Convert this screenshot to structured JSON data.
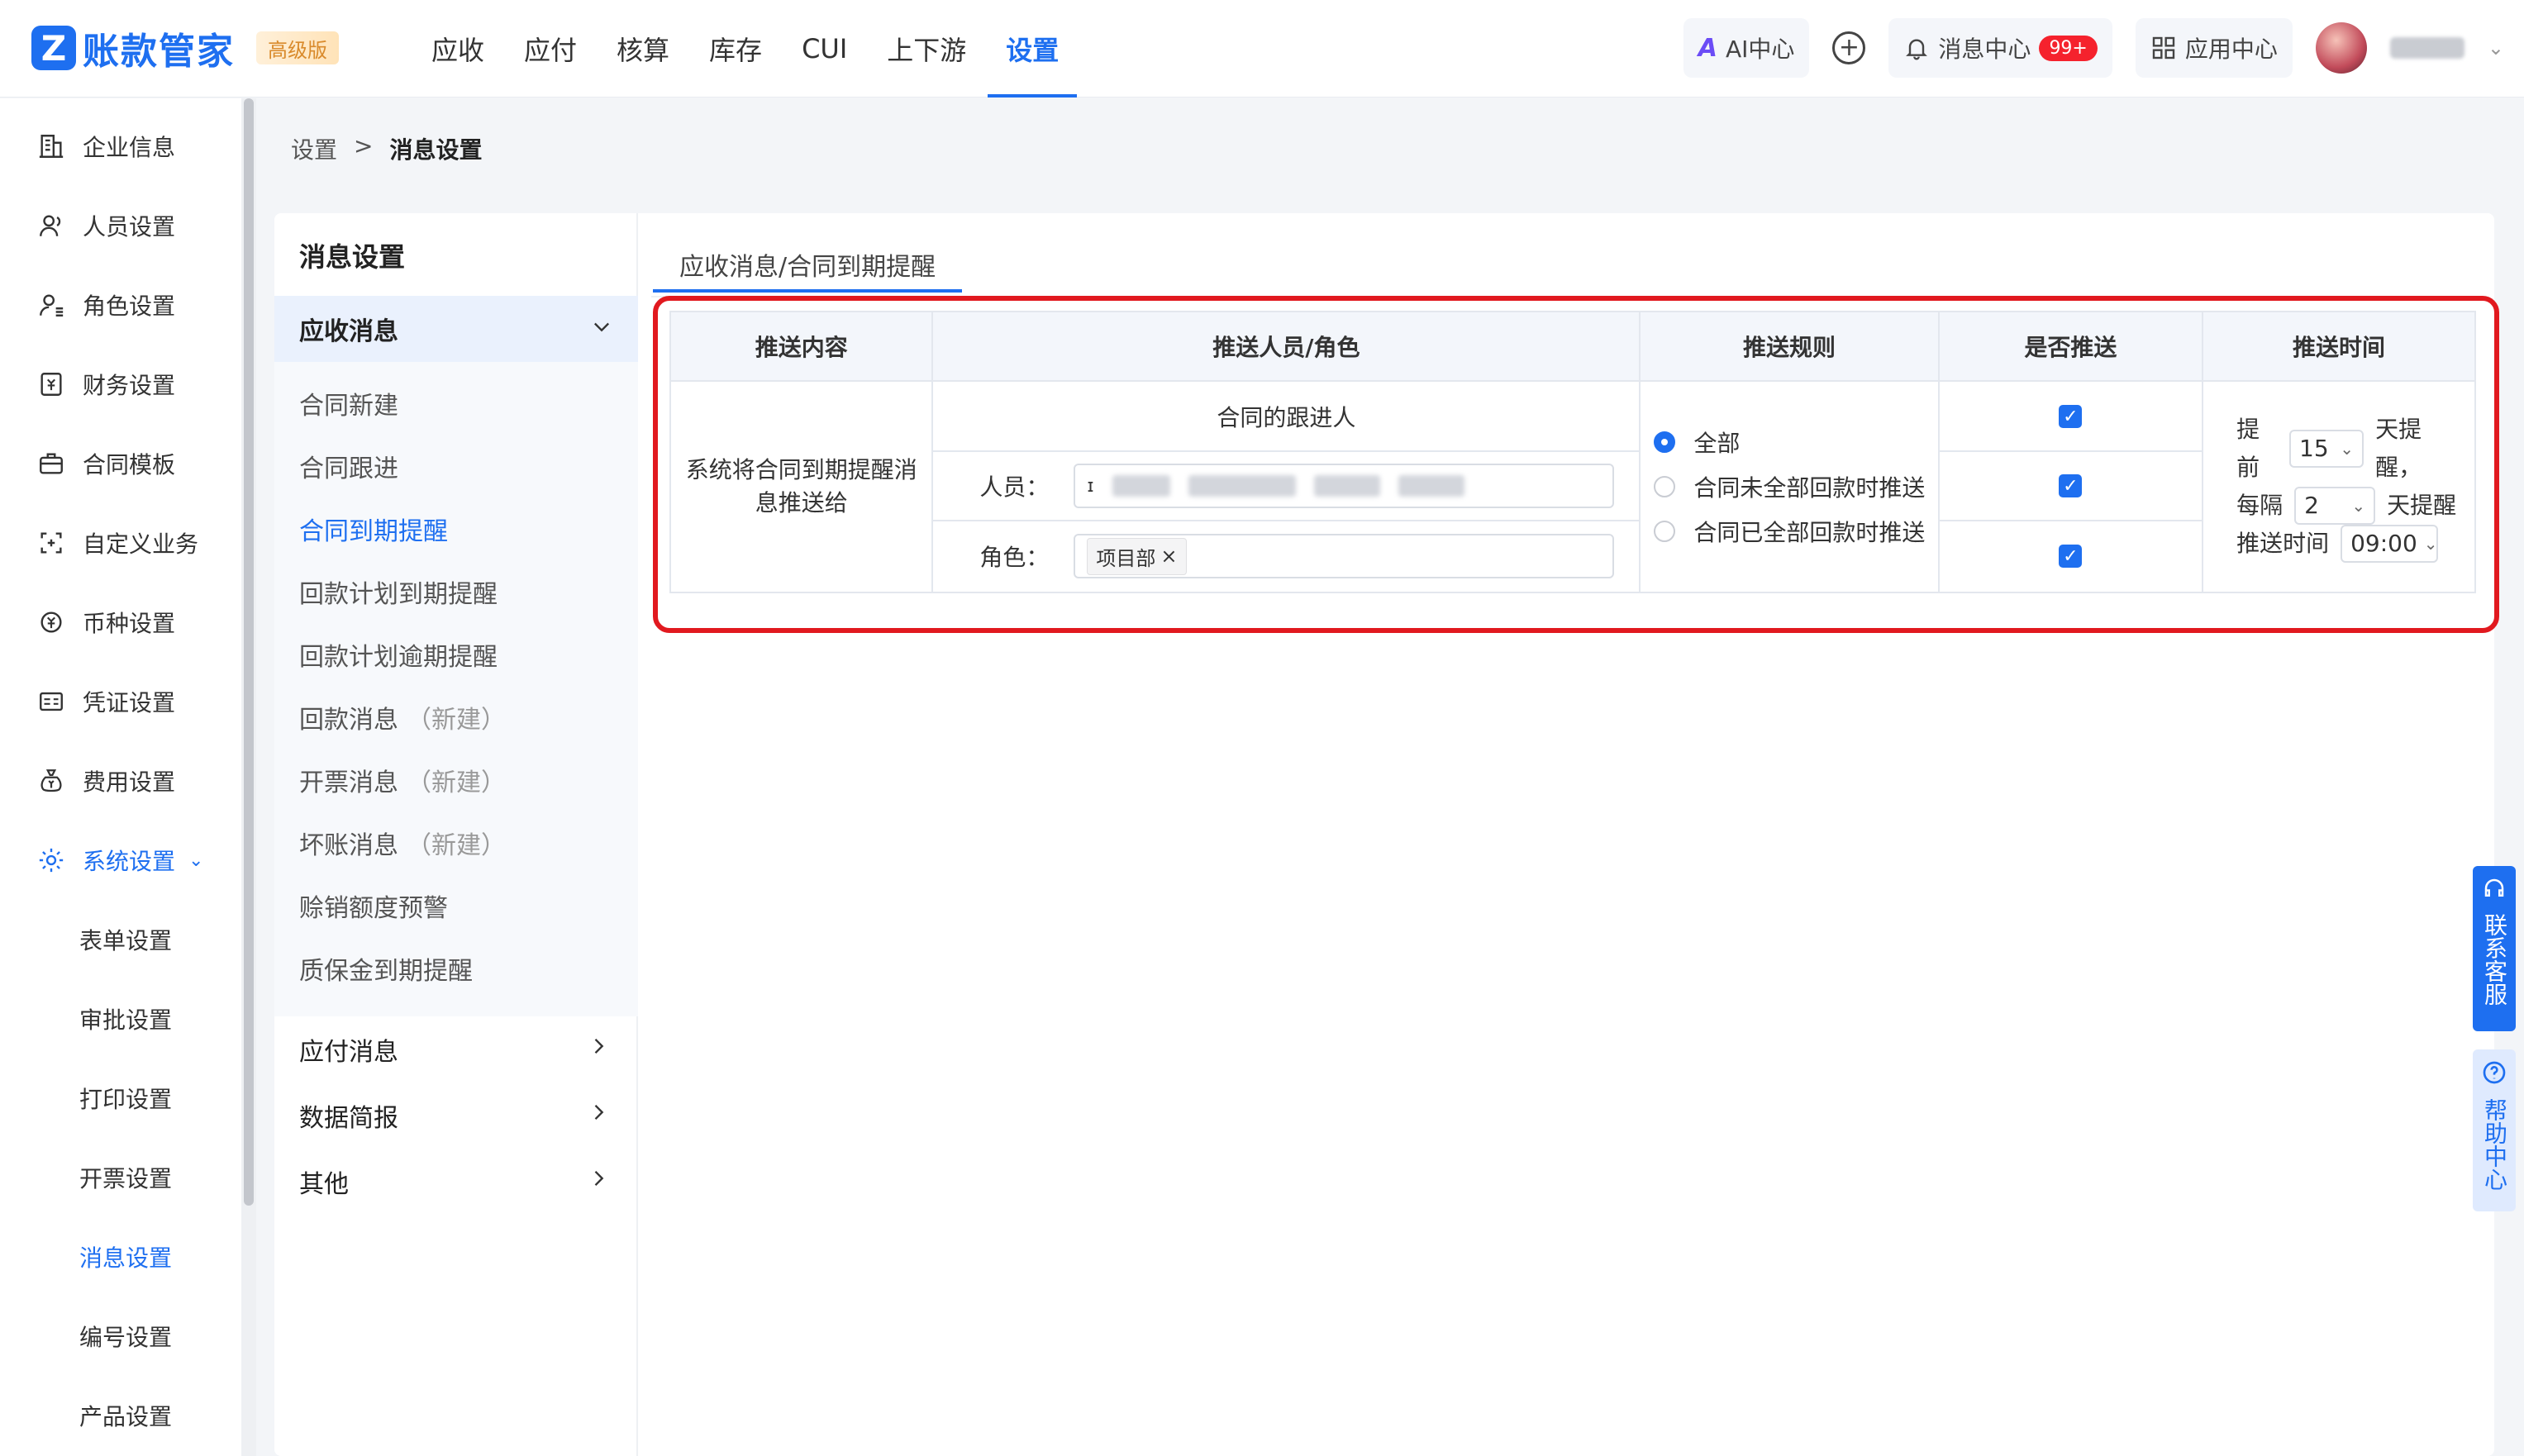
{
  "app": {
    "logo_mark": "Z",
    "name": "账款管家",
    "edition_badge": "高级版",
    "brand_color": "#1e6ff0"
  },
  "top_nav": [
    {
      "label": "应收",
      "active": false
    },
    {
      "label": "应付",
      "active": false
    },
    {
      "label": "核算",
      "active": false
    },
    {
      "label": "库存",
      "active": false
    },
    {
      "label": "CUI",
      "active": false
    },
    {
      "label": "上下游",
      "active": false
    },
    {
      "label": "设置",
      "active": true
    }
  ],
  "top_right": {
    "ai_center": "AI中心",
    "message_center": "消息中心",
    "message_count": "99+",
    "app_center": "应用中心"
  },
  "sidebar": {
    "items": [
      {
        "label": "企业信息",
        "icon": "building-icon"
      },
      {
        "label": "人员设置",
        "icon": "user-icon"
      },
      {
        "label": "角色设置",
        "icon": "user-role-icon"
      },
      {
        "label": "财务设置",
        "icon": "finance-icon"
      },
      {
        "label": "合同模板",
        "icon": "briefcase-icon"
      },
      {
        "label": "自定义业务",
        "icon": "custom-icon"
      },
      {
        "label": "币种设置",
        "icon": "currency-icon"
      },
      {
        "label": "凭证设置",
        "icon": "voucher-icon"
      },
      {
        "label": "费用设置",
        "icon": "money-bag-icon"
      }
    ],
    "system_group": {
      "label": "系统设置",
      "icon": "system-gear-icon"
    },
    "system_subitems": [
      {
        "label": "表单设置",
        "active": false
      },
      {
        "label": "审批设置",
        "active": false
      },
      {
        "label": "打印设置",
        "active": false
      },
      {
        "label": "开票设置",
        "active": false
      },
      {
        "label": "消息设置",
        "active": true
      },
      {
        "label": "编号设置",
        "active": false
      },
      {
        "label": "产品设置",
        "active": false
      }
    ]
  },
  "breadcrumb": {
    "parent": "设置",
    "separator": ">",
    "current": "消息设置"
  },
  "message_settings": {
    "title": "消息设置",
    "open_group": "应收消息",
    "sub_items": [
      {
        "label": "合同新建",
        "suffix": "",
        "active": false
      },
      {
        "label": "合同跟进",
        "suffix": "",
        "active": false
      },
      {
        "label": "合同到期提醒",
        "suffix": "",
        "active": true
      },
      {
        "label": "回款计划到期提醒",
        "suffix": "",
        "active": false
      },
      {
        "label": "回款计划逾期提醒",
        "suffix": "",
        "active": false
      },
      {
        "label": "回款消息",
        "suffix": "（新建）",
        "active": false
      },
      {
        "label": "开票消息",
        "suffix": "（新建）",
        "active": false
      },
      {
        "label": "坏账消息",
        "suffix": "（新建）",
        "active": false
      },
      {
        "label": "赊销额度预警",
        "suffix": "",
        "active": false
      },
      {
        "label": "质保金到期提醒",
        "suffix": "",
        "active": false
      }
    ],
    "collapsed_groups": [
      "应付消息",
      "数据简报",
      "其他"
    ]
  },
  "tab": {
    "label": "应收消息/合同到期提醒"
  },
  "rules_table": {
    "headers": [
      "推送内容",
      "推送人员/角色",
      "推送规则",
      "是否推送",
      "推送时间"
    ],
    "content_text": "系统将合同到期提醒消息推送给",
    "follower_label": "合同的跟进人",
    "person_label": "人员：",
    "person_value": "ɪ",
    "role_label": "角色：",
    "role_tag": "项目部",
    "rules": [
      {
        "label": "全部",
        "checked": true
      },
      {
        "label": "合同未全部回款时推送",
        "checked": false
      },
      {
        "label": "合同已全部回款时推送",
        "checked": false
      }
    ],
    "push_enabled": [
      true,
      true,
      true
    ],
    "time": {
      "before_label": "提前",
      "before_days": "15",
      "day_remind": "天提醒，",
      "interval_label": "每隔",
      "interval_days": "2",
      "interval_suffix": "天提醒",
      "push_time_label": "推送时间",
      "push_time": "09:00"
    }
  },
  "floating": {
    "service": "联系客服",
    "help": "帮助中心"
  }
}
